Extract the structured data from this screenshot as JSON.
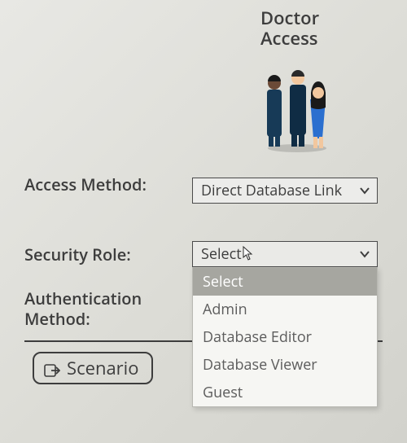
{
  "header": {
    "title_line1": "Doctor",
    "title_line2": "Access"
  },
  "form": {
    "access_method": {
      "label": "Access Method:",
      "value": "Direct Database Link"
    },
    "security_role": {
      "label": "Security Role:",
      "value": "Select",
      "options": [
        "Select",
        "Admin",
        "Database Editor",
        "Database Viewer",
        "Guest"
      ],
      "highlighted_index": 0
    },
    "auth_method": {
      "label": "Authentication Method:"
    }
  },
  "footer": {
    "scenario_button": "Scenario"
  }
}
